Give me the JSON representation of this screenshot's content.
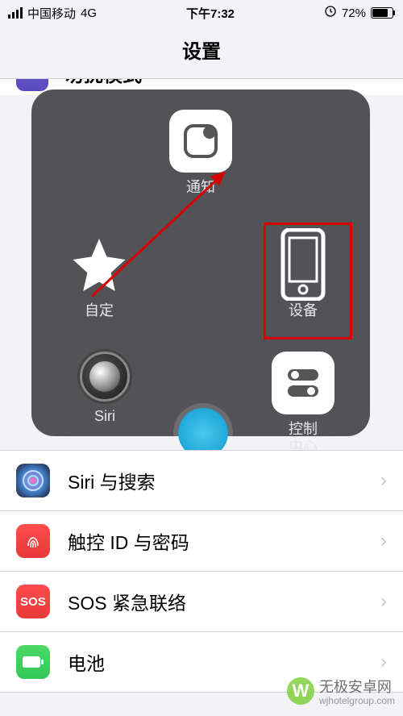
{
  "status": {
    "carrier": "中国移动",
    "network": "4G",
    "time": "下午7:32",
    "lock_icon": "rotation-lock-icon",
    "battery_pct": "72%"
  },
  "header": {
    "title": "设置"
  },
  "partial_row": {
    "label": "勿扰模式"
  },
  "assistive_touch": {
    "notify": "通知",
    "custom": "自定",
    "device": "设备",
    "siri": "Siri",
    "home": "主屏幕",
    "control_center": "控制\n中心"
  },
  "list": {
    "siri": "Siri 与搜索",
    "touchid": "触控 ID 与密码",
    "sos": "SOS 紧急联络",
    "battery": "电池",
    "sos_icon_text": "SOS"
  },
  "watermark": {
    "name": "无极安卓网",
    "url": "wjhotelgroup.com"
  }
}
